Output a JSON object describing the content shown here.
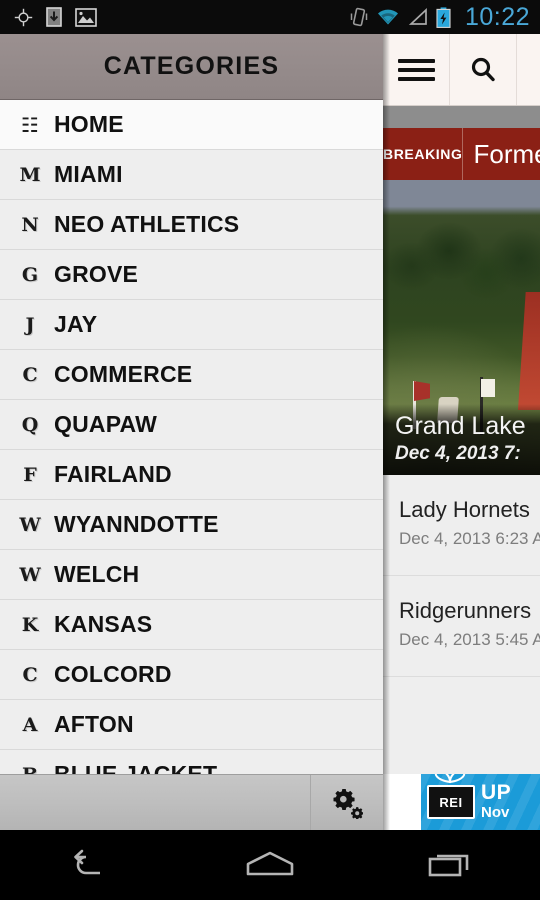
{
  "statusbar": {
    "time": "10:22",
    "left_icons": [
      "gps-icon",
      "download-icon",
      "screenshot-icon"
    ],
    "right_icons": [
      "vibrate-icon",
      "wifi-icon",
      "signal-icon",
      "battery-charging-icon"
    ],
    "accent_color": "#4aa8d8",
    "background": "#0b0b0b"
  },
  "drawer": {
    "title": "CATEGORIES",
    "header_bg": "#948a8a",
    "items": [
      {
        "icon": "document-icon",
        "glyph": "☷",
        "label": "HOME"
      },
      {
        "icon": "letter-m-icon",
        "glyph": "M",
        "label": "MIAMI"
      },
      {
        "icon": "letter-n-icon",
        "glyph": "N",
        "label": "NEO ATHLETICS"
      },
      {
        "icon": "letter-g-icon",
        "glyph": "G",
        "label": "GROVE"
      },
      {
        "icon": "letter-j-icon",
        "glyph": "J",
        "label": "JAY"
      },
      {
        "icon": "letter-c-icon",
        "glyph": "C",
        "label": "COMMERCE"
      },
      {
        "icon": "letter-q-icon",
        "glyph": "Q",
        "label": "QUAPAW"
      },
      {
        "icon": "letter-f-icon",
        "glyph": "F",
        "label": "FAIRLAND"
      },
      {
        "icon": "letter-w-icon",
        "glyph": "W",
        "label": "WYANNDOTTE"
      },
      {
        "icon": "letter-w-icon",
        "glyph": "W",
        "label": "WELCH"
      },
      {
        "icon": "letter-k-icon",
        "glyph": "K",
        "label": "KANSAS"
      },
      {
        "icon": "letter-c-icon",
        "glyph": "C",
        "label": "COLCORD"
      },
      {
        "icon": "letter-a-icon",
        "glyph": "A",
        "label": "AFTON"
      },
      {
        "icon": "letter-b-icon",
        "glyph": "B",
        "label": "BLUE JACKET"
      }
    ],
    "actionbar": {
      "settings_icon": "settings-gear-icon"
    }
  },
  "content": {
    "toolbar": {
      "menu_icon": "hamburger-menu-icon",
      "search_icon": "search-icon",
      "background": "#faf4f1"
    },
    "breaking": {
      "tag": "BREAKING",
      "headline": "Forme",
      "background": "#8b2015"
    },
    "hero": {
      "title": "Grand Lake",
      "date": "Dec 4, 2013 7:"
    },
    "articles": [
      {
        "title": "Lady Hornets",
        "date": "Dec 4, 2013 6:23 A"
      },
      {
        "title": "Ridgerunners",
        "date": "Dec 4, 2013 5:45 A"
      }
    ]
  },
  "ad": {
    "brand": "REI",
    "line1": "UP",
    "line2": "Nov",
    "background": "#1b9bd8"
  },
  "navbar": {
    "buttons": [
      {
        "icon": "back-icon",
        "label": "Back"
      },
      {
        "icon": "home-icon",
        "label": "Home"
      },
      {
        "icon": "recents-icon",
        "label": "Recent apps"
      }
    ]
  }
}
